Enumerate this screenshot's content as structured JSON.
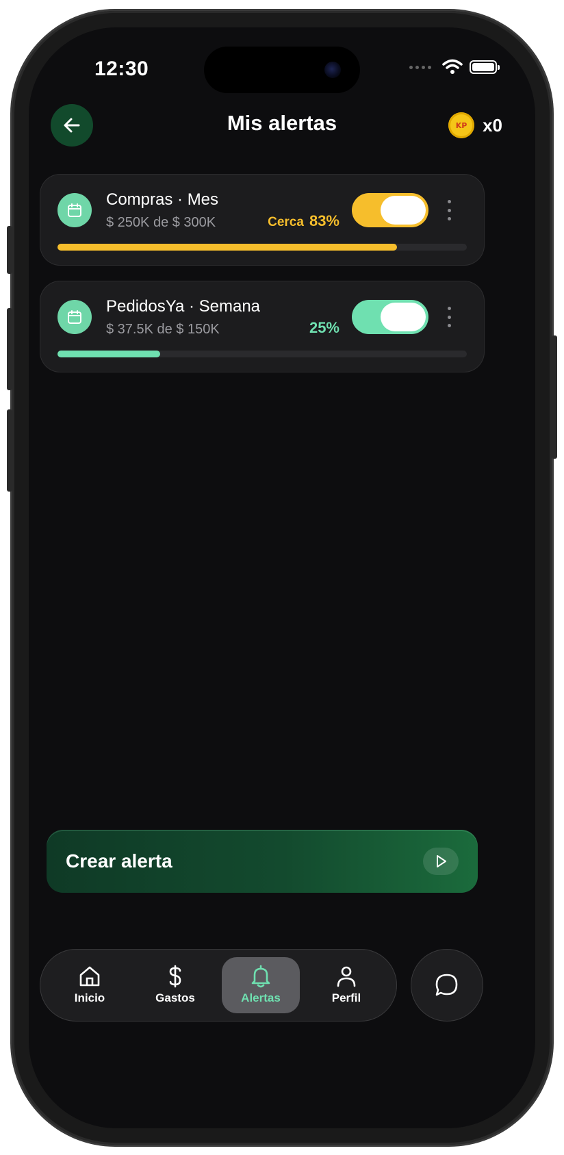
{
  "status_bar": {
    "time": "12:30"
  },
  "header": {
    "title": "Mis alertas",
    "coin_badge": "KP",
    "coin_count": "x0"
  },
  "alerts": [
    {
      "title": "Compras · Mes",
      "subtitle": "$ 250K de $ 300K",
      "status_label": "Cerca",
      "percent_label": "83%",
      "progress": 0.83,
      "enabled": true,
      "accent_color": "#f6be2c"
    },
    {
      "title": "PedidosYa · Semana",
      "subtitle": "$ 37.5K de $ 150K",
      "status_label": "",
      "percent_label": "25%",
      "progress": 0.25,
      "enabled": true,
      "accent_color": "#6fe0b0"
    }
  ],
  "create_button": {
    "label": "Crear alerta"
  },
  "bottom_nav": {
    "items": [
      {
        "label": "Inicio",
        "icon": "home-icon"
      },
      {
        "label": "Gastos",
        "icon": "dollar-icon"
      },
      {
        "label": "Alertas",
        "icon": "bell-icon",
        "active": true
      },
      {
        "label": "Perfil",
        "icon": "user-icon"
      }
    ]
  },
  "colors": {
    "accent_green": "#6fe0b0",
    "accent_yellow": "#f6be2c",
    "background": "#0d0d0f"
  }
}
